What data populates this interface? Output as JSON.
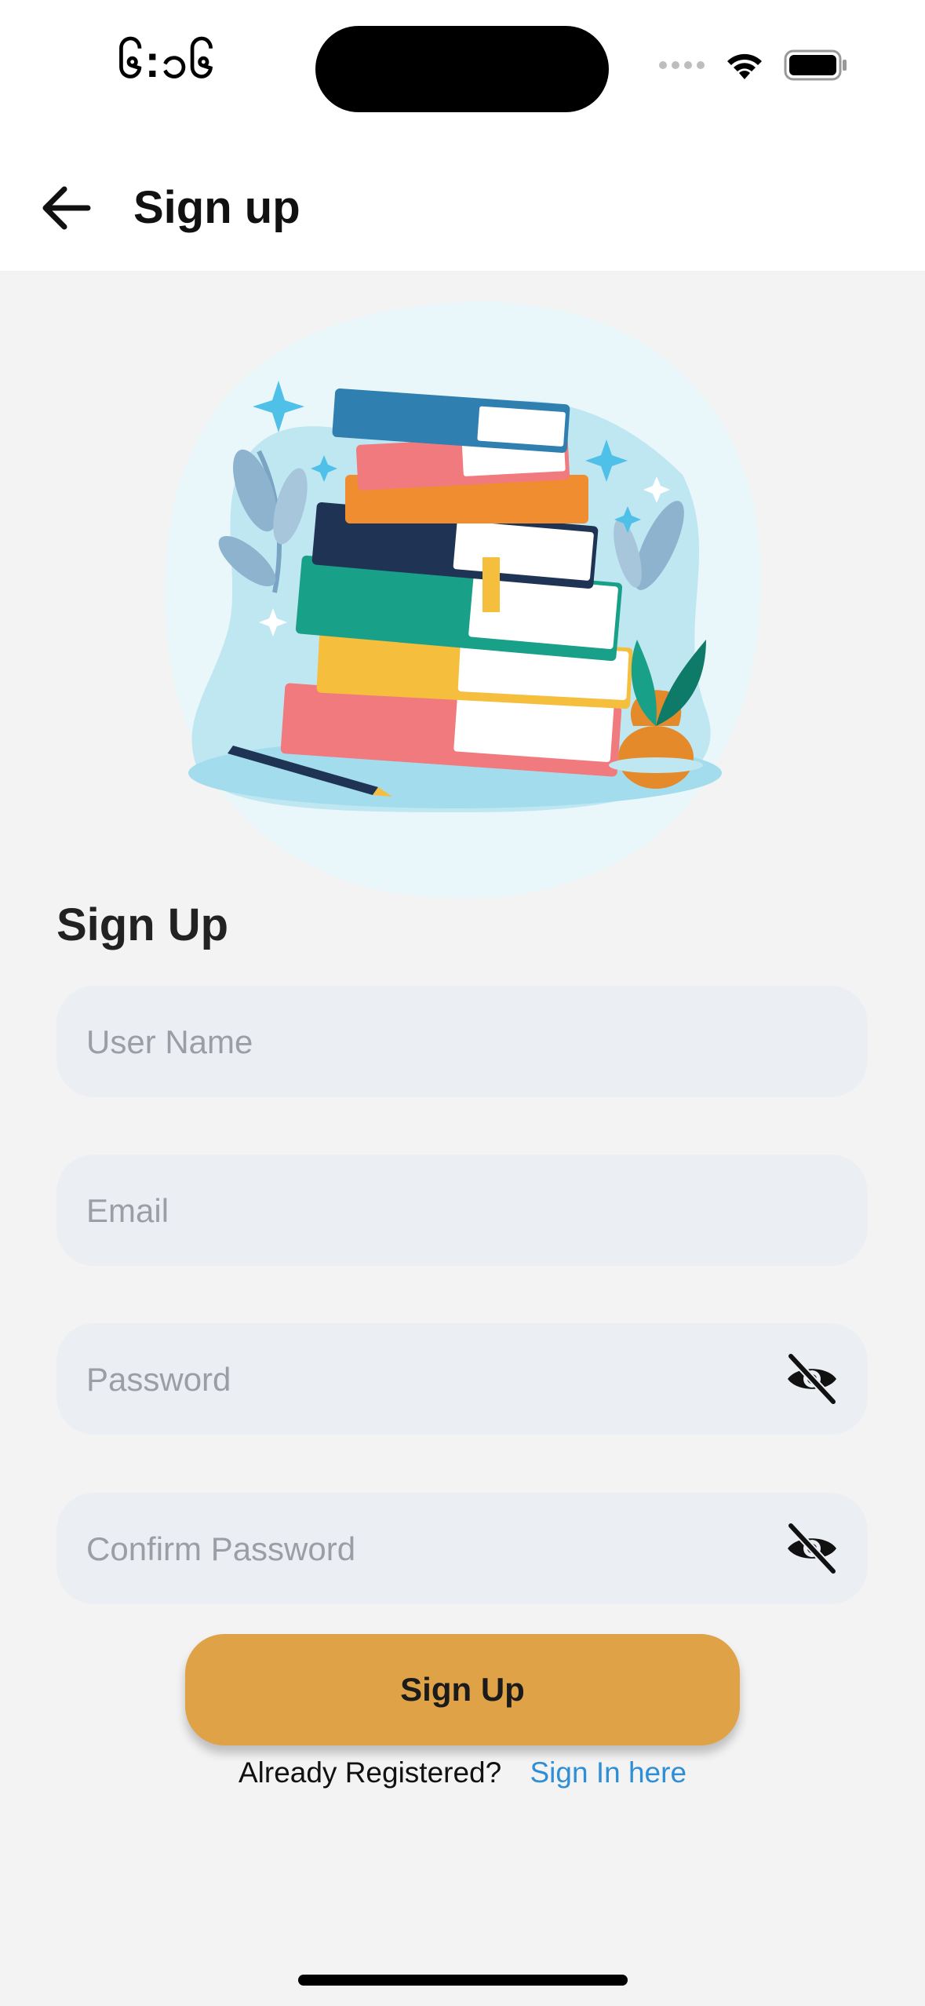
{
  "status_bar": {
    "time": "၆:၁၆",
    "icons": [
      "signal-dots-icon",
      "wifi-icon",
      "battery-icon"
    ]
  },
  "nav": {
    "back_icon": "arrow-left-icon",
    "title": "Sign up"
  },
  "illustration": {
    "icon": "books-stack-illustration"
  },
  "form": {
    "heading": "Sign Up",
    "username": {
      "placeholder": "User Name",
      "value": ""
    },
    "email": {
      "placeholder": "Email",
      "value": ""
    },
    "password": {
      "placeholder": "Password",
      "value": "",
      "toggle_icon": "eye-off-icon"
    },
    "confirm_password": {
      "placeholder": "Confirm Password",
      "value": "",
      "toggle_icon": "eye-off-icon"
    },
    "submit_label": "Sign Up"
  },
  "footer": {
    "prompt": "Already Registered?",
    "link": "Sign In here"
  },
  "colors": {
    "accent": "#dfa247",
    "link": "#2f8fd6",
    "field_bg": "#ebeef3",
    "page_bg": "#f3f3f3"
  }
}
